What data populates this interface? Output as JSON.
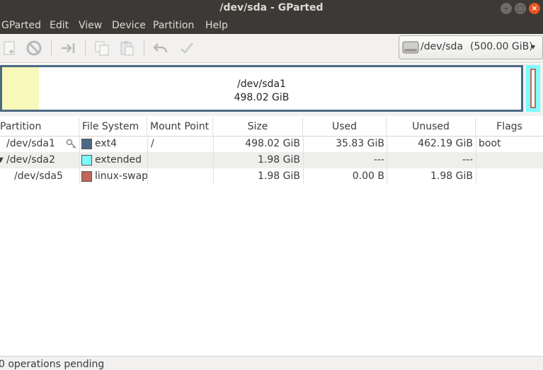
{
  "window": {
    "title": "/dev/sda - GParted"
  },
  "menu": [
    "GParted",
    "Edit",
    "View",
    "Device",
    "Partition",
    "Help"
  ],
  "toolbar": {
    "icons": [
      "new-partition-icon",
      "delete-icon",
      "resize-move-icon",
      "copy-icon",
      "paste-icon",
      "undo-icon",
      "apply-icon"
    ]
  },
  "device": {
    "name": "/dev/sda",
    "size": "(500.00 GiB)"
  },
  "diskmap": {
    "partition_name": "/dev/sda1",
    "partition_size": "498.02 GiB"
  },
  "table": {
    "headers": [
      "Partition",
      "File System",
      "Mount Point",
      "Size",
      "Used",
      "Unused",
      "Flags"
    ],
    "rows": [
      {
        "partition": "/dev/sda1",
        "fs": "ext4",
        "fs_color": "#4b6983",
        "mount": "/",
        "size": "498.02 GiB",
        "used": "35.83 GiB",
        "unused": "462.19 GiB",
        "flags": "boot"
      },
      {
        "partition": "/dev/sda2",
        "fs": "extended",
        "fs_color": "#7dfcfe",
        "mount": "",
        "size": "1.98 GiB",
        "used": "---",
        "unused": "---",
        "flags": ""
      },
      {
        "partition": "/dev/sda5",
        "fs": "linux-swap",
        "fs_color": "#c1665a",
        "mount": "",
        "size": "1.98 GiB",
        "used": "0.00 B",
        "unused": "1.98 GiB",
        "flags": ""
      }
    ]
  },
  "status": {
    "text": "0 operations pending"
  }
}
